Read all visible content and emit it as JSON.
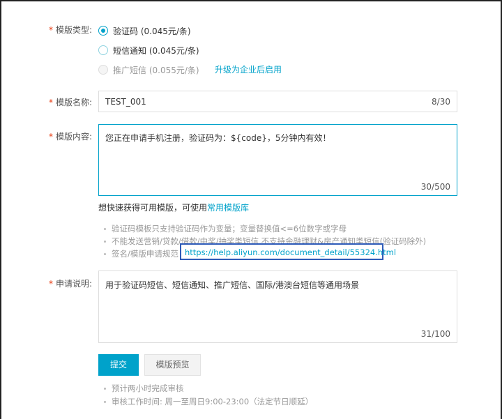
{
  "form": {
    "type_label": "模版类型:",
    "name_label": "模版名称:",
    "content_label": "模版内容:",
    "desc_label": "申请说明:",
    "required_mark": "*"
  },
  "template_types": [
    {
      "label": "验证码 (0.045元/条)",
      "checked": true,
      "disabled": false
    },
    {
      "label": "短信通知 (0.045元/条)",
      "checked": false,
      "disabled": false
    },
    {
      "label": "推广短信 (0.055元/条)",
      "checked": false,
      "disabled": true
    }
  ],
  "upgrade_link": "升级为企业后启用",
  "name_field": {
    "value": "TEST_001",
    "counter": "8/30"
  },
  "content_field": {
    "value": "您正在申请手机注册，验证码为：${code}，5分钟内有效！",
    "counter": "30/500"
  },
  "quick_hint": {
    "text": "想快速获得可用模版，可使用",
    "link": "常用模版库"
  },
  "rules": [
    "验证码模板只支持验证码作为变量；变量替换值<=6位数字或字母",
    "不能发送营销/贷款/借款/中奖/抽奖类短信,不支持金融理财&房产通知类短信(验证码除外)",
    "签名/模版申请规范"
  ],
  "help_url": "https://help.aliyun.com/document_detail/55324.html",
  "desc_field": {
    "value": "用于验证码短信、短信通知、推广短信、国际/港澳台短信等通用场景",
    "counter": "31/100"
  },
  "buttons": {
    "submit": "提交",
    "preview": "模版预览"
  },
  "footer_notes": [
    "预计两小时完成审核",
    "审核工作时间: 周一至周日9:00-23:00（法定节日顺延）"
  ],
  "colors": {
    "accent": "#00a2ca",
    "required": "#e8380d",
    "highlight_box": "#2e5bb8"
  }
}
